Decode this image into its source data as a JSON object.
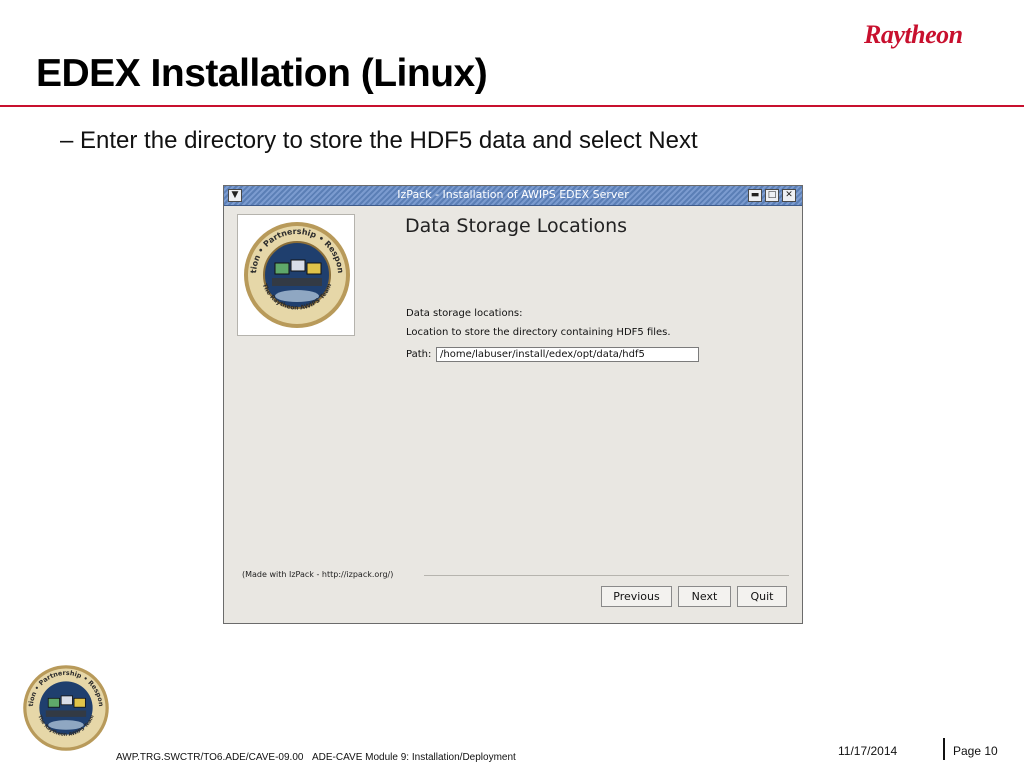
{
  "slide": {
    "title": "EDEX Installation (Linux)",
    "brand": "Raytheon",
    "bullet": "– Enter the directory to store the HDF5 data and select Next"
  },
  "window": {
    "title": "IzPack - Installation of AWIPS EDEX Server",
    "panel_title": "Data Storage Locations",
    "label_locations": "Data storage locations:",
    "label_description": "Location to store the directory containing HDF5 files.",
    "path_label": "Path:",
    "path_value": "/home/labuser/install/edex/opt/data/hdf5",
    "made_with": "(Made with IzPack - http://izpack.org/)",
    "buttons": {
      "previous": "Previous",
      "next": "Next",
      "quit": "Quit"
    }
  },
  "seal": {
    "ring_text": "Innovation • Partnership • Responsibility",
    "team_text": "The Raytheon AWIPS Team"
  },
  "footer": {
    "doc_id": "AWP.TRG.SWCTR/TO6.ADE/CAVE-09.00",
    "module": "ADE-CAVE Module 9: Installation/Deployment",
    "date": "11/17/2014",
    "page": "Page 10"
  },
  "colors": {
    "accent": "#c8102e",
    "titlebar": "#6a8cc4",
    "window_bg": "#e9e7e2"
  }
}
